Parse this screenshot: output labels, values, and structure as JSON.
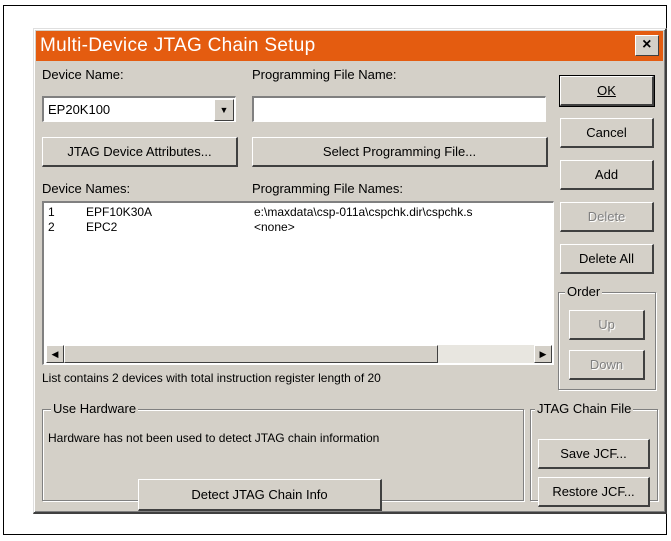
{
  "dialog": {
    "title": "Multi-Device JTAG Chain Setup",
    "close_glyph": "×",
    "title_color": "#e45c10"
  },
  "labels": {
    "device_name": "Device Name:",
    "programming_file_name": "Programming File Name:",
    "device_names": "Device Names:",
    "programming_file_names": "Programming File Names:"
  },
  "inputs": {
    "device_select_value": "EP20K100",
    "programming_file_value": ""
  },
  "buttons": {
    "jtag_attributes": "JTAG Device Attributes...",
    "select_programming_file": "Select Programming File...",
    "ok": "OK",
    "cancel": "Cancel",
    "add": "Add",
    "delete": "Delete",
    "delete_all": "Delete All",
    "up": "Up",
    "down": "Down",
    "detect_jtag": "Detect JTAG Chain Info",
    "save_jcf": "Save JCF...",
    "restore_jcf": "Restore JCF..."
  },
  "device_list": {
    "rows": [
      {
        "index": "1",
        "device": "EPF10K30A",
        "file": "e:\\maxdata\\csp-011a\\cspchk.dir\\cspchk.s"
      },
      {
        "index": "2",
        "device": "EPC2",
        "file": "<none>"
      }
    ]
  },
  "status_text": "List contains 2 devices with total instruction register length of 20",
  "order_group": {
    "title": "Order"
  },
  "hardware_group": {
    "title": "Use Hardware",
    "message": "Hardware has not been used to detect JTAG chain information"
  },
  "jcf_group": {
    "title": "JTAG Chain File"
  },
  "icons": {
    "dropdown": "chevron-down-icon",
    "scroll_left": "arrow-left-icon",
    "scroll_right": "arrow-right-icon",
    "close": "close-icon"
  }
}
